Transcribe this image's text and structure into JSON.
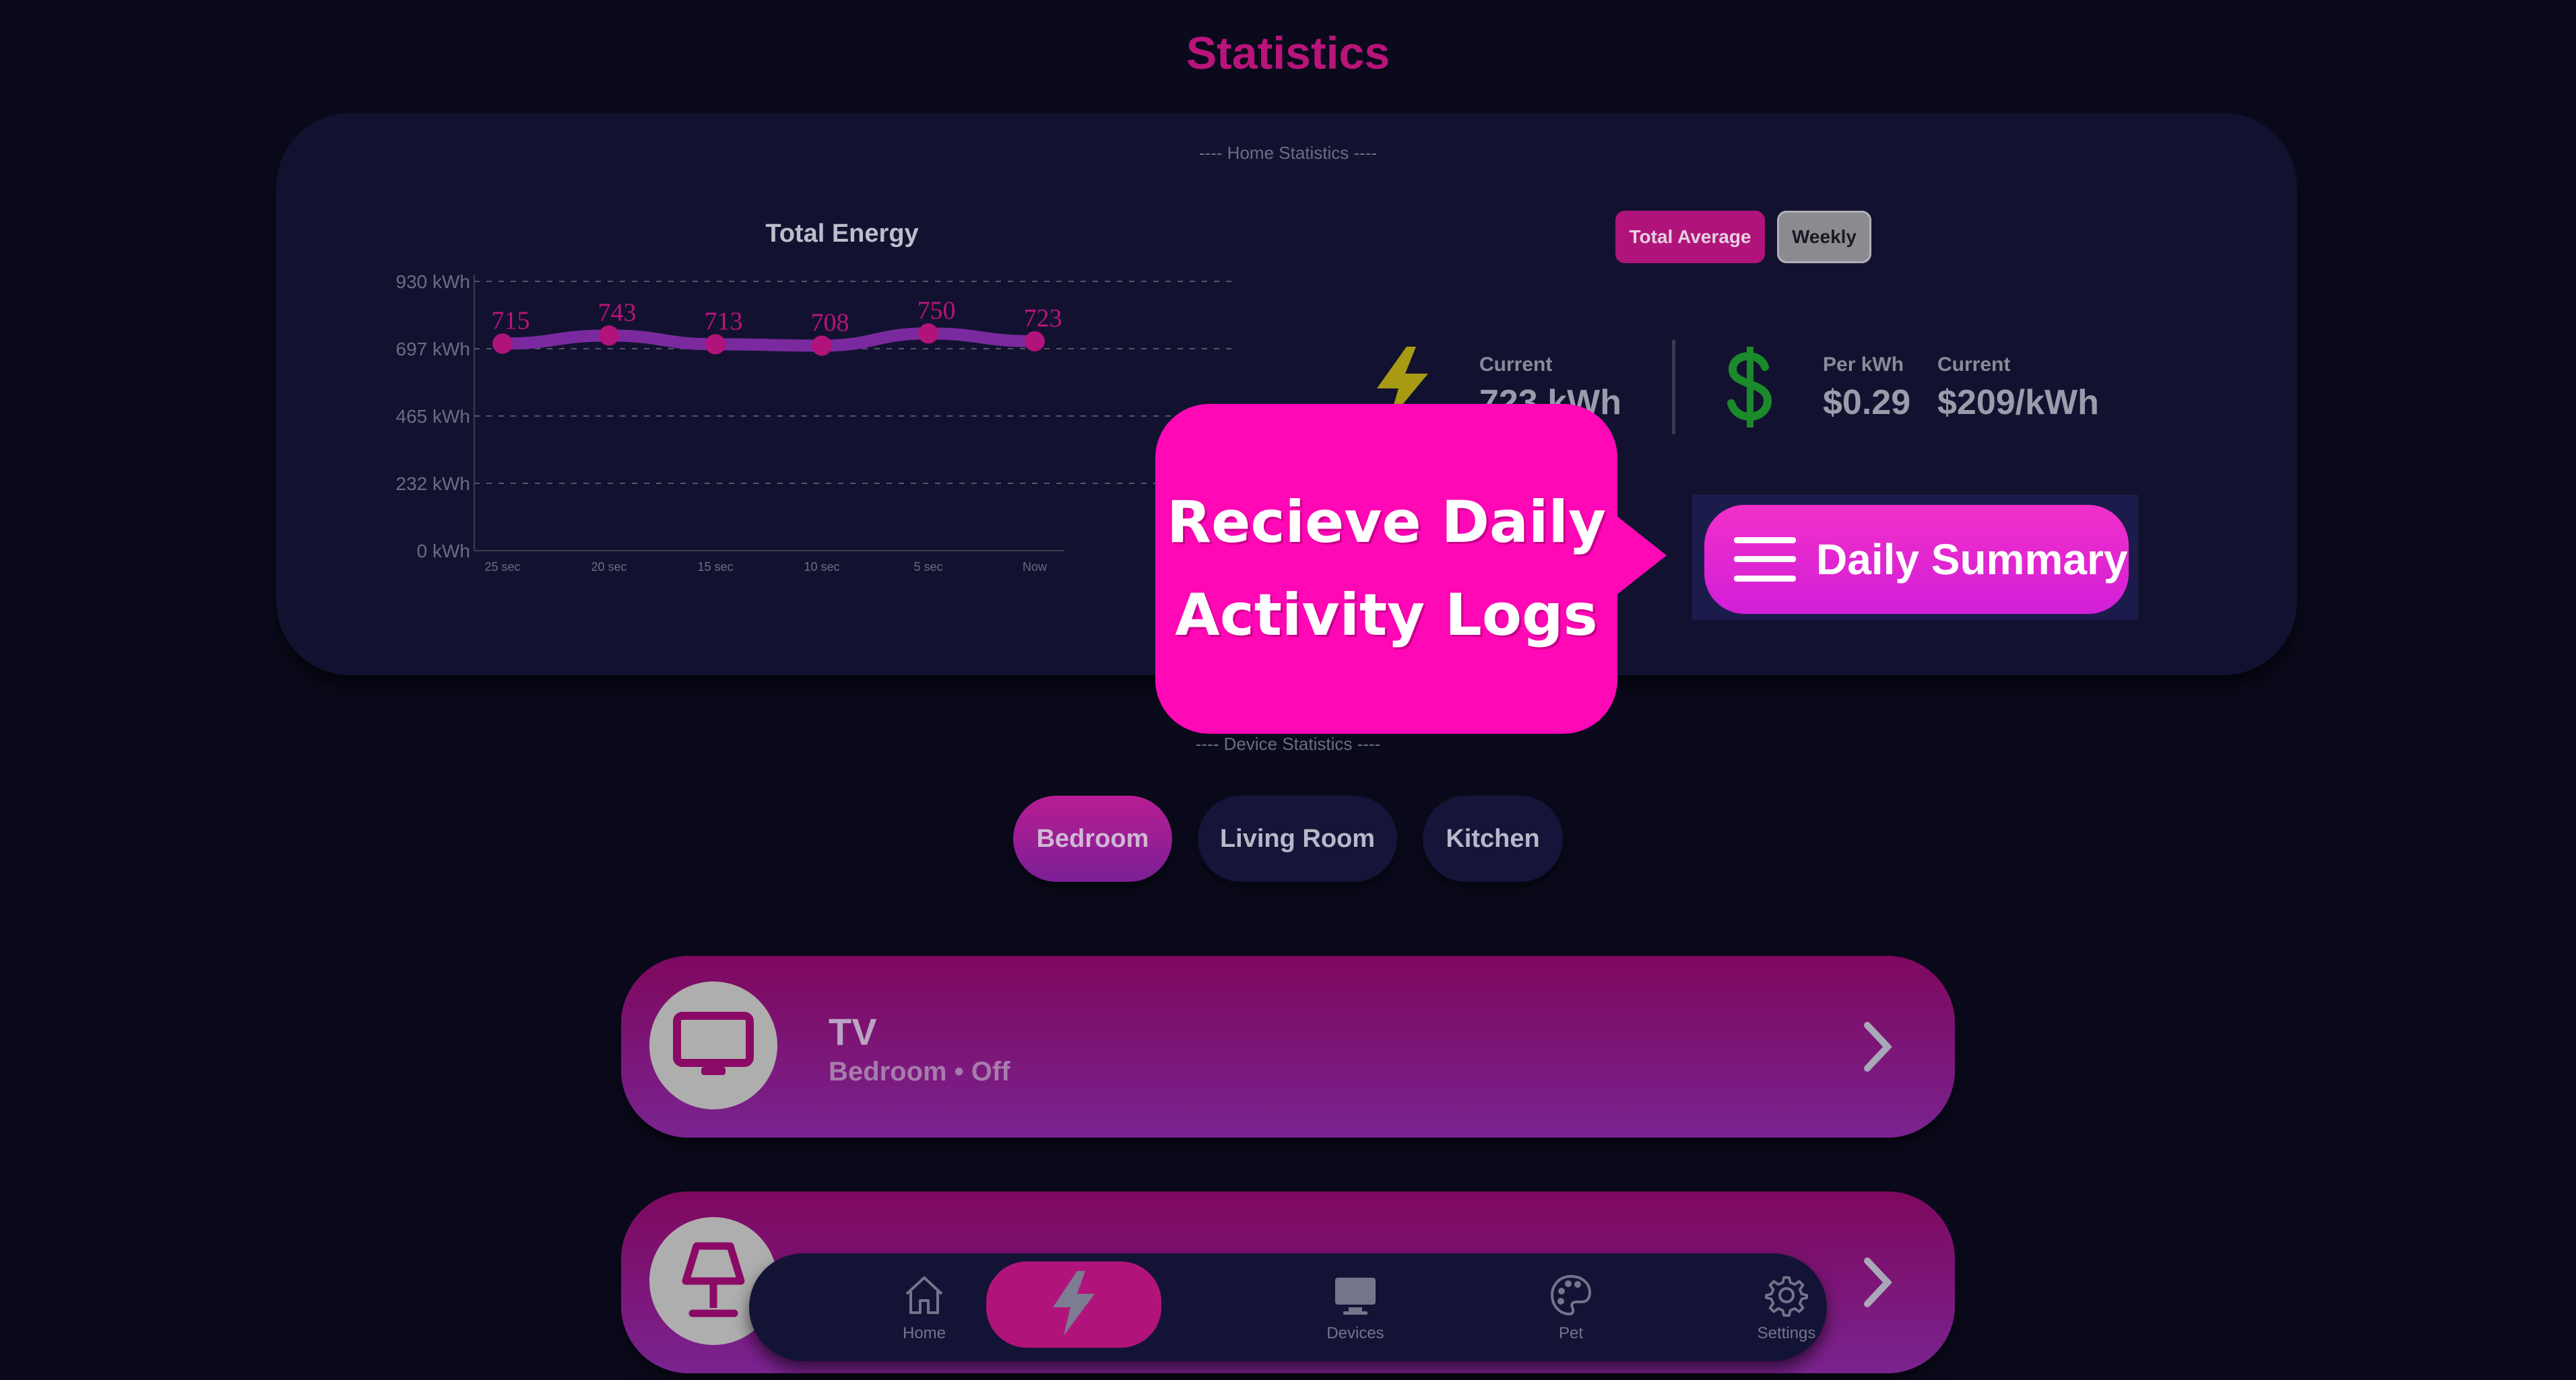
{
  "page": {
    "title": "Statistics"
  },
  "home_stats": {
    "section_label": "---- Home Statistics ----",
    "chart_title": "Total Energy",
    "range_buttons": {
      "total_average": "Total Average",
      "weekly": "Weekly"
    },
    "energy": {
      "caption": "Current",
      "value": "723 kWh",
      "icon": "lightning-bolt-icon",
      "icon_color": "#a89a12"
    },
    "cost": {
      "icon": "dollar-sign-icon",
      "icon_color": "#1b8a2a",
      "per_kwh_caption": "Per kWh",
      "per_kwh_value": "$0.29",
      "current_caption": "Current",
      "current_value": "$209/kWh"
    },
    "summary_button": {
      "label": "Daily Summary",
      "icon": "hamburger-menu-icon"
    }
  },
  "tooltip": {
    "line1": "Recieve Daily",
    "line2": "Activity Logs",
    "color": "#ff08b5"
  },
  "device_stats": {
    "section_label": "---- Device Statistics ----",
    "rooms": [
      "Bedroom",
      "Living Room",
      "Kitchen"
    ],
    "selected_room": "Bedroom",
    "devices": [
      {
        "name": "TV",
        "subtitle": "Bedroom • Off",
        "icon": "tv-icon"
      },
      {
        "name": "",
        "subtitle": "",
        "icon": "lamp-icon"
      }
    ]
  },
  "bottom_nav": {
    "items": [
      {
        "label": "Home",
        "icon": "home-icon"
      },
      {
        "label": "",
        "icon": "lightning-bolt-icon",
        "active": true
      },
      {
        "label": "Devices",
        "icon": "monitor-icon"
      },
      {
        "label": "Pet",
        "icon": "palette-icon"
      },
      {
        "label": "Settings",
        "icon": "gear-icon"
      }
    ]
  },
  "chart_data": {
    "type": "line",
    "title": "Total Energy",
    "categories": [
      "25 sec",
      "20 sec",
      "15 sec",
      "10 sec",
      "5 sec",
      "Now"
    ],
    "values": [
      715,
      743,
      713,
      708,
      750,
      723
    ],
    "y_ticks": [
      "930 kWh",
      "697 kWh",
      "465 kWh",
      "232 kWh",
      "0 kWh"
    ],
    "ylim": [
      0,
      930
    ],
    "grid": "dashed horizontal",
    "line_color": "#7a2a9e",
    "point_color": "#b0147a"
  },
  "colors": {
    "accent": "#b8147a",
    "background": "#0a0a1c",
    "panel": "#121230"
  }
}
